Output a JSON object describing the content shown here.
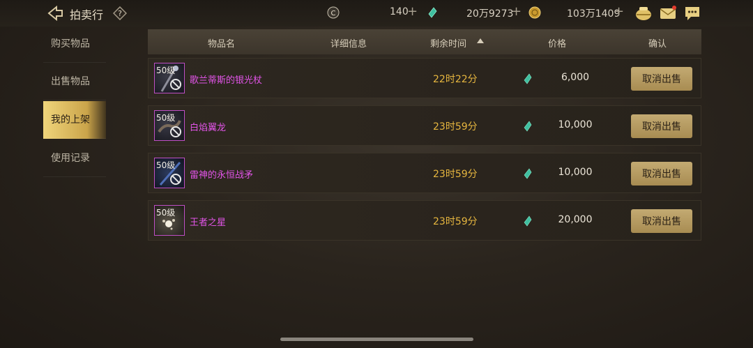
{
  "header": {
    "title": "拍卖行",
    "currency": [
      {
        "icon": "silver-coin-icon",
        "value": "140"
      },
      {
        "icon": "green-gem-icon",
        "value": "20万9273"
      },
      {
        "icon": "gold-coin-icon",
        "value": "103万1409"
      }
    ],
    "plus": "+"
  },
  "sidebar": {
    "items": [
      {
        "label": "购买物品"
      },
      {
        "label": "出售物品"
      },
      {
        "label": "我的上架"
      },
      {
        "label": "使用记录"
      }
    ]
  },
  "table": {
    "columns": [
      "物品名",
      "详细信息",
      "剩余时间",
      "价格",
      "确认"
    ],
    "rows": [
      {
        "level": "50级",
        "name": "歌兰蒂斯的银光杖",
        "time": "22时22分",
        "price": "6,000",
        "action": "取消出售"
      },
      {
        "level": "50级",
        "name": "白焰翼龙",
        "time": "23时59分",
        "price": "10,000",
        "action": "取消出售"
      },
      {
        "level": "50级",
        "name": "雷神的永恒战矛",
        "time": "23时59分",
        "price": "10,000",
        "action": "取消出售"
      },
      {
        "level": "50级",
        "name": "王者之星",
        "time": "23时59分",
        "price": "20,000",
        "action": "取消出售"
      }
    ]
  },
  "colors": {
    "accent_gold": "#c3aa72",
    "item_name": "#e254e8",
    "time": "#e6b63f",
    "active_tab": "#f0d57b"
  }
}
